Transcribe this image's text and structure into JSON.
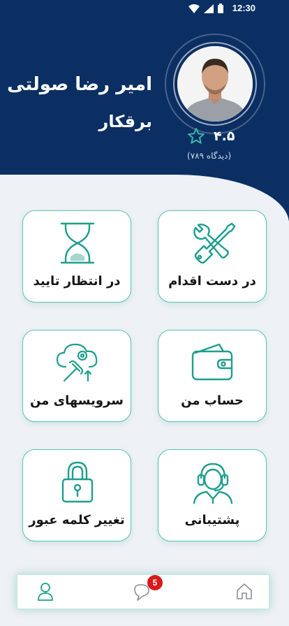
{
  "status_bar": {
    "time": "12:30"
  },
  "header": {
    "name": "امیر رضا صولتی",
    "role": "برقکار",
    "rating": "۴.۵",
    "reviews": "(دیدگاه ۷۸۹)"
  },
  "menu": {
    "items": [
      {
        "label": "در دست اقدام",
        "icon": "tools-icon"
      },
      {
        "label": "در انتظار تایید",
        "icon": "hourglass-icon"
      },
      {
        "label": "حساب من",
        "icon": "wallet-icon"
      },
      {
        "label": "سرویسهای من",
        "icon": "cloud-services-icon"
      },
      {
        "label": "پشتیبانی",
        "icon": "support-agent-icon"
      },
      {
        "label": "تغییر کلمه عبور",
        "icon": "lock-icon"
      }
    ]
  },
  "bottom_nav": {
    "messages_badge": "5"
  },
  "colors": {
    "primary": "#0b2f63",
    "accent": "#3fb9a8",
    "badge": "#d81a1a"
  }
}
